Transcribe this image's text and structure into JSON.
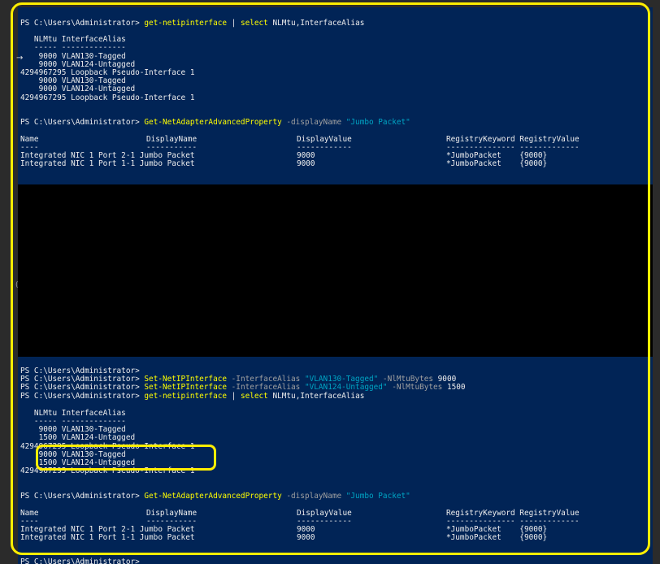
{
  "prompt": "PS C:\\Users\\Administrator>",
  "block1": {
    "cmd1": "get-netipinterface",
    "pipe": " | ",
    "cmd2": "select",
    "args": " NLMtu,InterfaceAlias",
    "header": "   NLMtu InterfaceAlias",
    "underline": "   ----- --------------",
    "rows": [
      "    9000 VLAN130-Tagged",
      "    9000 VLAN124-Untagged",
      "4294967295 Loopback Pseudo-Interface 1",
      "    9000 VLAN130-Tagged",
      "    9000 VLAN124-Untagged",
      "4294967295 Loopback Pseudo-Interface 1"
    ]
  },
  "block2": {
    "cmd": "Get-NetAdapterAdvancedProperty",
    "param": " -displayName ",
    "value": "\"Jumbo Packet\"",
    "header": "Name                          DisplayName                    DisplayValue                   RegistryKeyword RegistryValue",
    "underline": "----                          -----------                    ------------                   --------------- -------------",
    "rows": [
      "Integrated NIC 1 Port 2-1 Jumbo Packet                   9000                           *JumboPacket    {9000}",
      "Integrated NIC 1 Port 1-1 Jumbo Packet                   9000                           *JumboPacket    {9000}"
    ]
  },
  "block3": {
    "set1_cmd": "Set-NetIPInterface",
    "set1_param1": " -InterfaceAlias ",
    "set1_val1": "\"VLAN130-Tagged\"",
    "set1_param2": " -NlMtuBytes ",
    "set1_val2": "9000",
    "set2_cmd": "Set-NetIPInterface",
    "set2_param1": " -InterfaceAlias ",
    "set2_val1": "\"VLAN124-Untagged\"",
    "set2_param2": " -NlMtuBytes ",
    "set2_val2": "1500",
    "get_cmd": "get-netipinterface",
    "get_pipe": " | ",
    "get_select": "select",
    "get_args": " NLMtu,InterfaceAlias",
    "header": "   NLMtu InterfaceAlias",
    "underline": "   ----- --------------",
    "rows": [
      "    9000 VLAN130-Tagged",
      "    1500 VLAN124-Untagged",
      "4294967295 Loopback Pseudo-Interface 1",
      "    9000 VLAN130-Tagged",
      "    1500 VLAN124-Untagged",
      "4294967295 Loopback Pseudo-Interface 1"
    ]
  },
  "block4": {
    "cmd": "Get-NetAdapterAdvancedProperty",
    "param": " -displayName ",
    "value": "\"Jumbo Packet\"",
    "header": "Name                          DisplayName                    DisplayValue                   RegistryKeyword RegistryValue",
    "underline": "----                          -----------                    ------------                   --------------- -------------",
    "rows": [
      "Integrated NIC 1 Port 2-1 Jumbo Packet                   9000                           *JumboPacket    {9000}",
      "Integrated NIC 1 Port 1-1 Jumbo Packet                   9000                           *JumboPacket    {9000}"
    ]
  },
  "colors": {
    "background": "#012456",
    "command": "#ffff00",
    "parameter": "#a0a0a0",
    "string": "#00a5c4",
    "highlight": "#ffee00"
  }
}
